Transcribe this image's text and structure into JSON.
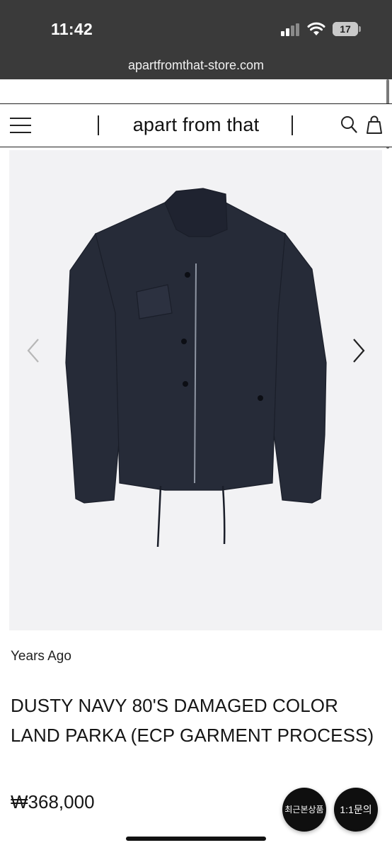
{
  "status_bar": {
    "time": "11:42",
    "battery_level": "17",
    "icons": [
      "signal-icon",
      "wifi-icon",
      "battery-icon"
    ]
  },
  "browser": {
    "url": "apartfromthat-store.com"
  },
  "header": {
    "brand": "apart from that",
    "icons": [
      "menu-icon",
      "search-icon",
      "shopping-bag-icon"
    ]
  },
  "gallery": {
    "image_subject": "jacket-image",
    "icons": [
      "chevron-left-icon",
      "chevron-right-icon"
    ],
    "background_color": "#f2f2f4"
  },
  "product": {
    "brand_label": "Years Ago",
    "title": "DUSTY NAVY 80'S DAMAGED COLOR LAND PARKA (ECP GARMENT PROCESS)",
    "price": "₩368,000"
  },
  "floating_buttons": {
    "recent": "최근본상품",
    "inquiry": "1:1문의"
  },
  "colors": {
    "status_bar_bg": "#3a3a3a",
    "jacket": "#262b38"
  }
}
